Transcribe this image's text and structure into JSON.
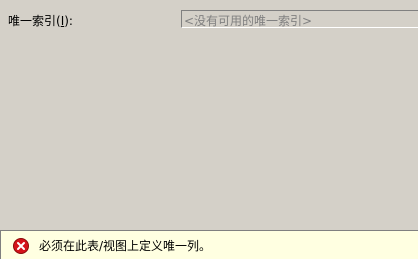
{
  "unique_index": {
    "label_prefix": "唯一索引(",
    "label_accel": "I",
    "label_suffix": "):",
    "combo_value": "<没有可用的唯一索引>"
  },
  "status": {
    "icon": "error-icon",
    "message": "必须在此表/视图上定义唯一列。",
    "colors": {
      "background": "#ffffe1",
      "icon": "#d4131a"
    }
  }
}
